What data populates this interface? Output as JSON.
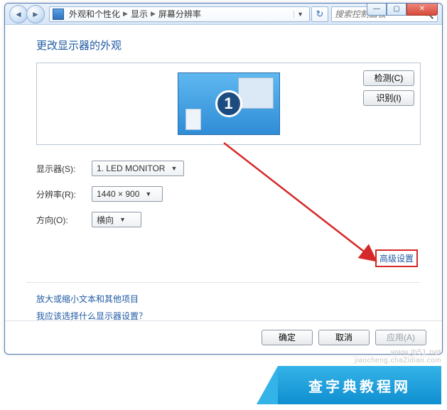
{
  "window": {
    "sys": {
      "min": "—",
      "max": "▢",
      "close": "✕"
    }
  },
  "breadcrumb": {
    "items": [
      "外观和个性化",
      "显示",
      "屏幕分辨率"
    ]
  },
  "toolbar": {
    "refresh_icon": "↻"
  },
  "search": {
    "placeholder": "搜索控制面板"
  },
  "page": {
    "title": "更改显示器的外观",
    "detect_btn": "检测(C)",
    "identify_btn": "识别(I)",
    "monitor_num": "1",
    "advanced_link": "高级设置",
    "links": {
      "resize_text": "放大或缩小文本和其他项目",
      "which_display": "我应该选择什么显示器设置？"
    }
  },
  "form": {
    "display_label": "显示器(S):",
    "display_value": "1. LED MONITOR",
    "resolution_label": "分辨率(R):",
    "resolution_value": "1440 × 900",
    "orientation_label": "方向(O):",
    "orientation_value": "横向"
  },
  "footer": {
    "ok": "确定",
    "cancel": "取消",
    "apply": "应用(A)"
  },
  "watermark": {
    "url": "www.jb51.net",
    "sub": "jiaocheng.chaZidian.com",
    "brand": "查字典教程网"
  }
}
